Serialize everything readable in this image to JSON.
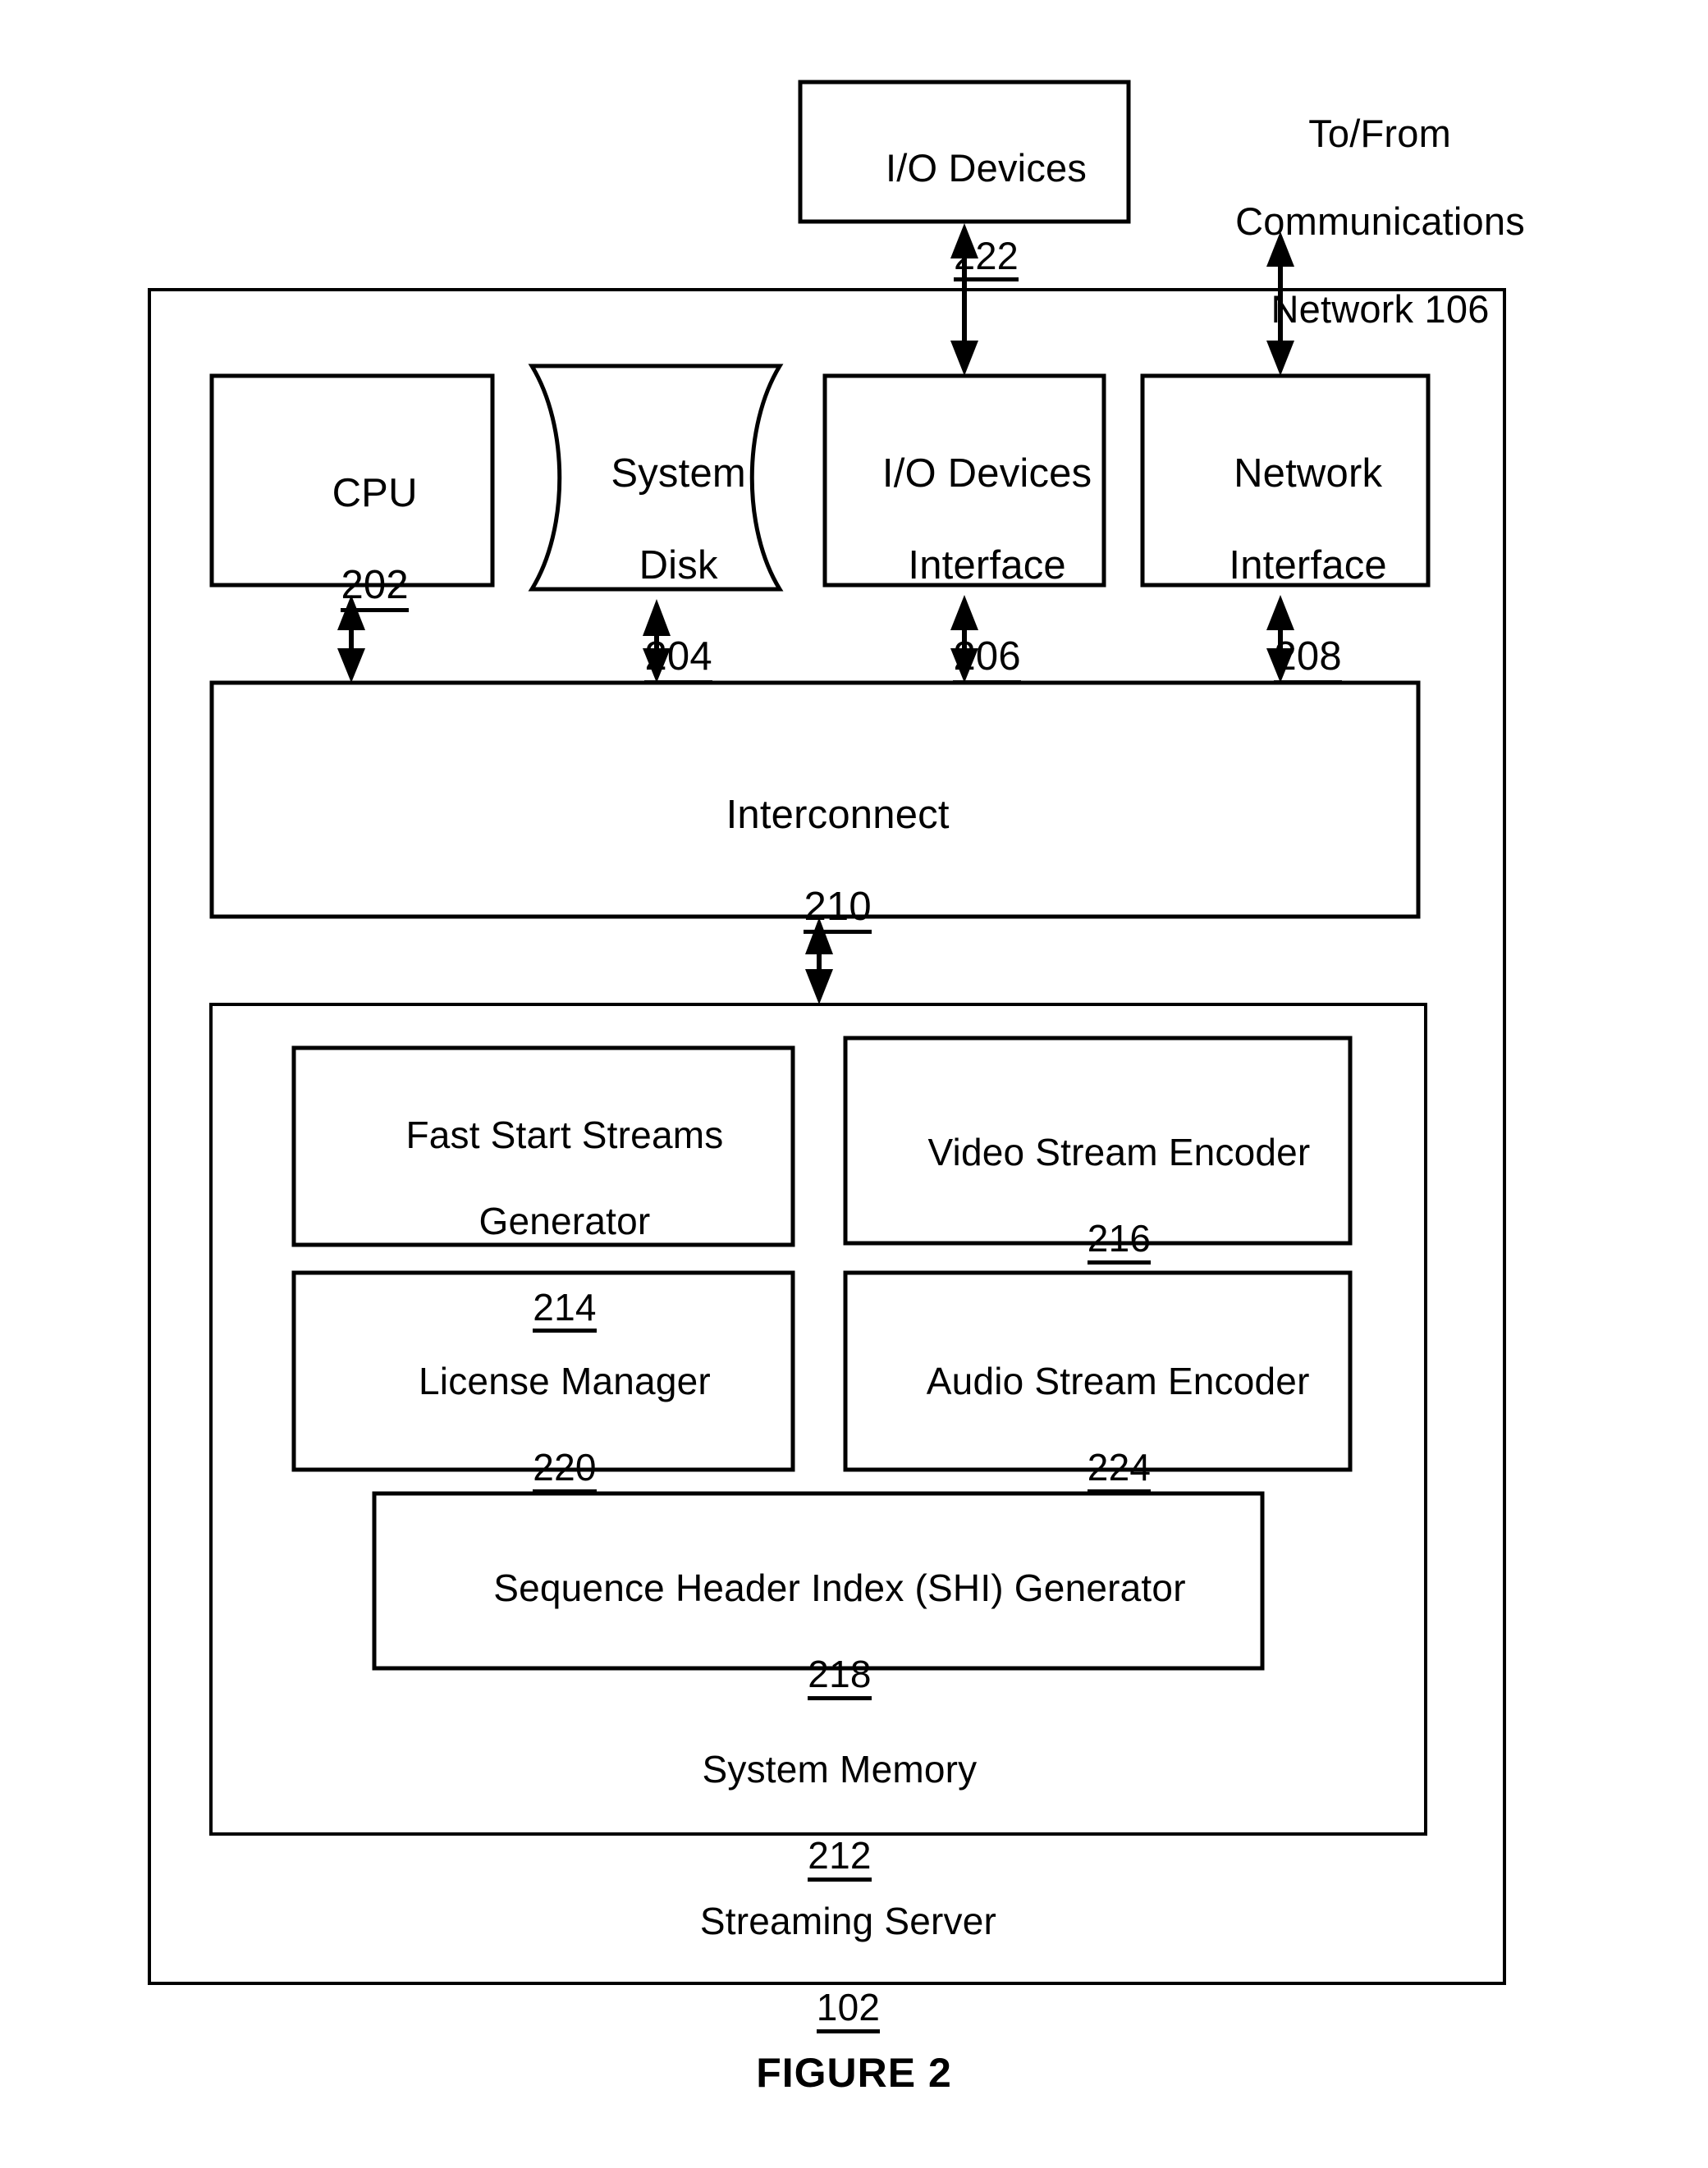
{
  "figure": {
    "caption": "FIGURE 2"
  },
  "external": {
    "io_devices": {
      "title": "I/O Devices",
      "ref": "222"
    },
    "network_note": {
      "line1": "To/From",
      "line2": "Communications",
      "line3": "Network 106"
    }
  },
  "server": {
    "title": "Streaming Server",
    "ref": "102",
    "hardware": [
      {
        "title": "CPU",
        "ref": "202",
        "shape": "rect"
      },
      {
        "title_line1": "System",
        "title_line2": "Disk",
        "ref": "204",
        "shape": "cylinder"
      },
      {
        "title_line1": "I/O Devices",
        "title_line2": "Interface",
        "ref": "206",
        "shape": "rect"
      },
      {
        "title_line1": "Network",
        "title_line2": "Interface",
        "ref": "208",
        "shape": "rect"
      }
    ],
    "interconnect": {
      "title": "Interconnect",
      "ref": "210"
    },
    "memory": {
      "title": "System Memory",
      "ref": "212",
      "modules": [
        {
          "title_line1": "Fast Start Streams",
          "title_line2": "Generator",
          "ref": "214"
        },
        {
          "title": "Video Stream Encoder",
          "ref": "216"
        },
        {
          "title": "License Manager",
          "ref": "220"
        },
        {
          "title": "Audio Stream Encoder",
          "ref": "224"
        },
        {
          "title": "Sequence Header Index (SHI) Generator",
          "ref": "218"
        }
      ]
    }
  },
  "colors": {
    "stroke": "#000000",
    "background": "#ffffff"
  }
}
